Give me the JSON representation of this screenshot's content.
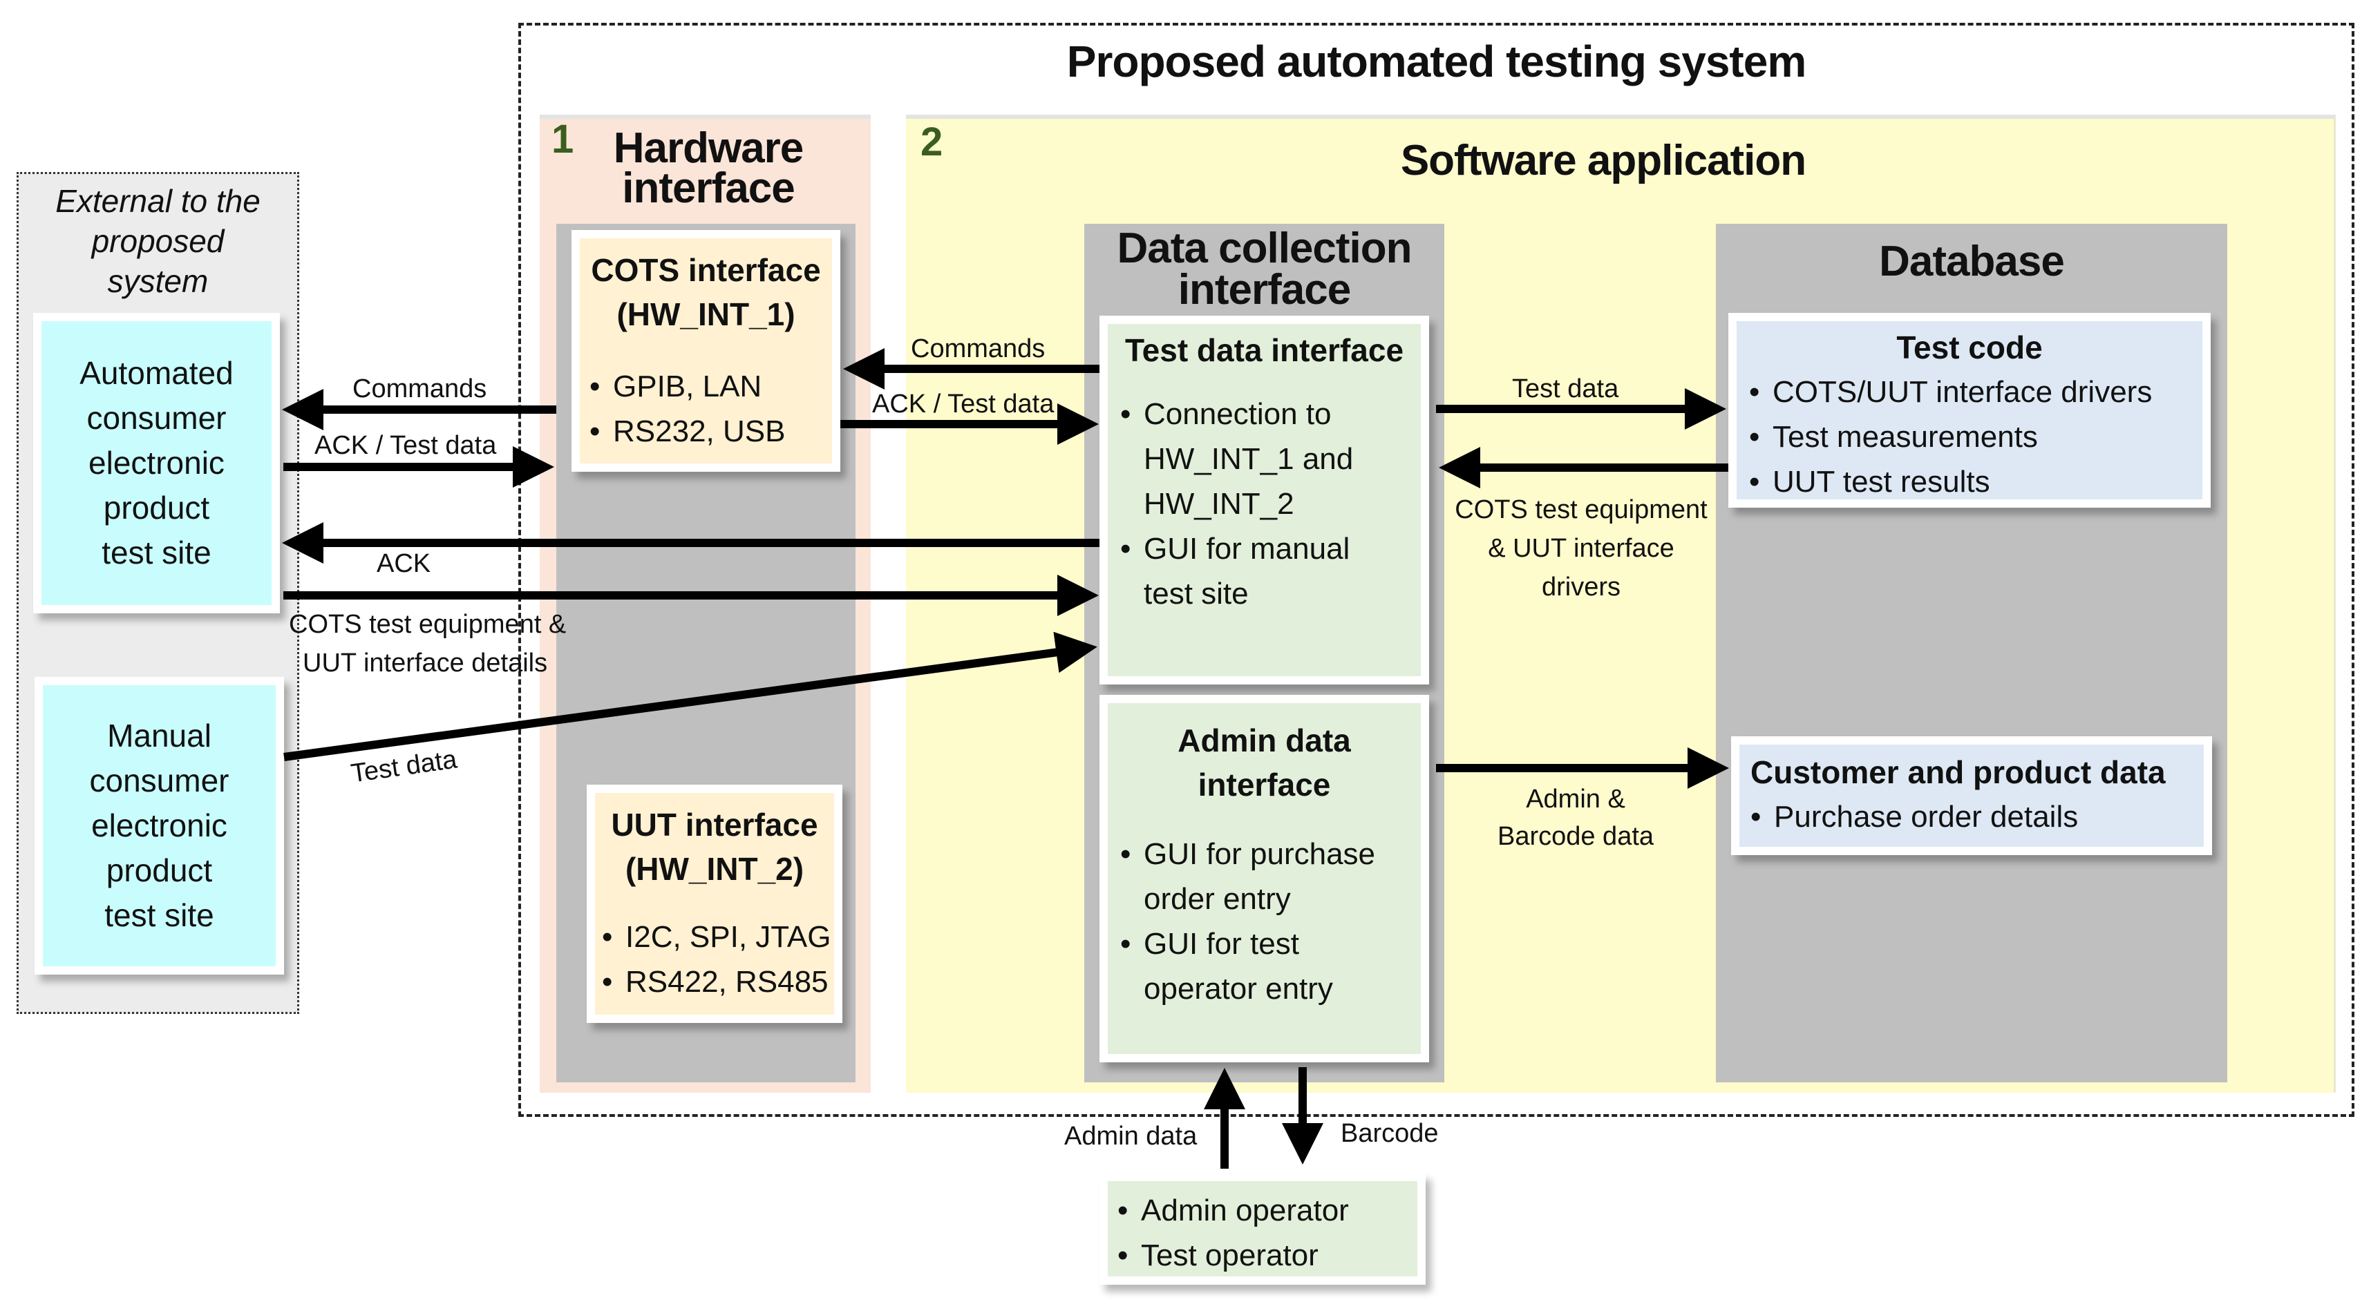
{
  "title": "Proposed automated testing system",
  "external": {
    "label_lines": [
      "External to the",
      "proposed",
      "system"
    ],
    "automated_site": [
      "Automated",
      "consumer",
      "electronic",
      "product",
      "test site"
    ],
    "manual_site": [
      "Manual",
      "consumer",
      "electronic",
      "product",
      "test site"
    ]
  },
  "hardware": {
    "number": "1",
    "title_lines": [
      "Hardware",
      "interface"
    ],
    "cots": {
      "title_lines": [
        "COTS  interface",
        "(HW_INT_1)"
      ],
      "bullets": [
        "GPIB, LAN",
        "RS232, USB"
      ]
    },
    "uut": {
      "title_lines": [
        "UUT interface",
        "(HW_INT_2)"
      ],
      "bullets": [
        "I2C, SPI, JTAG",
        "RS422, RS485"
      ]
    }
  },
  "software": {
    "number": "2",
    "title": "Software application",
    "data_collection": {
      "title_lines": [
        "Data collection",
        "interface"
      ],
      "test_data_interface": {
        "title": "Test data interface",
        "bullets": [
          [
            "Connection to",
            "HW_INT_1 and",
            "HW_INT_2"
          ],
          [
            "GUI for manual",
            "test site"
          ]
        ]
      },
      "admin_data_interface": {
        "title_lines": [
          "Admin data",
          "interface"
        ],
        "bullets": [
          [
            "GUI for purchase",
            "order entry"
          ],
          [
            "GUI for test",
            "operator entry"
          ]
        ]
      }
    },
    "database": {
      "title": "Database",
      "test_code": {
        "title": "Test code",
        "bullets": [
          "COTS/UUT interface drivers",
          "Test measurements",
          "UUT test results"
        ]
      },
      "customer_product": {
        "title": "Customer and product data",
        "bullets": [
          "Purchase order details"
        ]
      }
    }
  },
  "operators": {
    "bullets": [
      "Admin operator",
      "Test operator"
    ]
  },
  "arrow_labels": {
    "commands_left": "Commands",
    "ack_test_data_left": "ACK / Test data",
    "ack": "ACK",
    "cots_details_lines": [
      "COTS test equipment &",
      "UUT interface details"
    ],
    "test_data_manual": "Test data",
    "commands_mid": "Commands",
    "ack_test_data_mid": "ACK / Test data",
    "test_data_db": "Test data",
    "cots_drivers_lines": [
      "COTS test equipment",
      "& UUT interface",
      "drivers"
    ],
    "admin_barcode_lines": [
      "Admin &",
      "Barcode data"
    ],
    "admin_data": "Admin data",
    "barcode": "Barcode"
  },
  "colors": {
    "external_bg": "#ececec",
    "site_bg": "#c9fdfd",
    "hardware_bg": "#fbe5d8",
    "software_bg": "#fefbcc",
    "gray_container": "#bfbfbf",
    "peach_box": "#fff1d2",
    "green_box": "#e2efda",
    "blue_box": "#dde8f4",
    "number_green": "#3b5e1f"
  }
}
